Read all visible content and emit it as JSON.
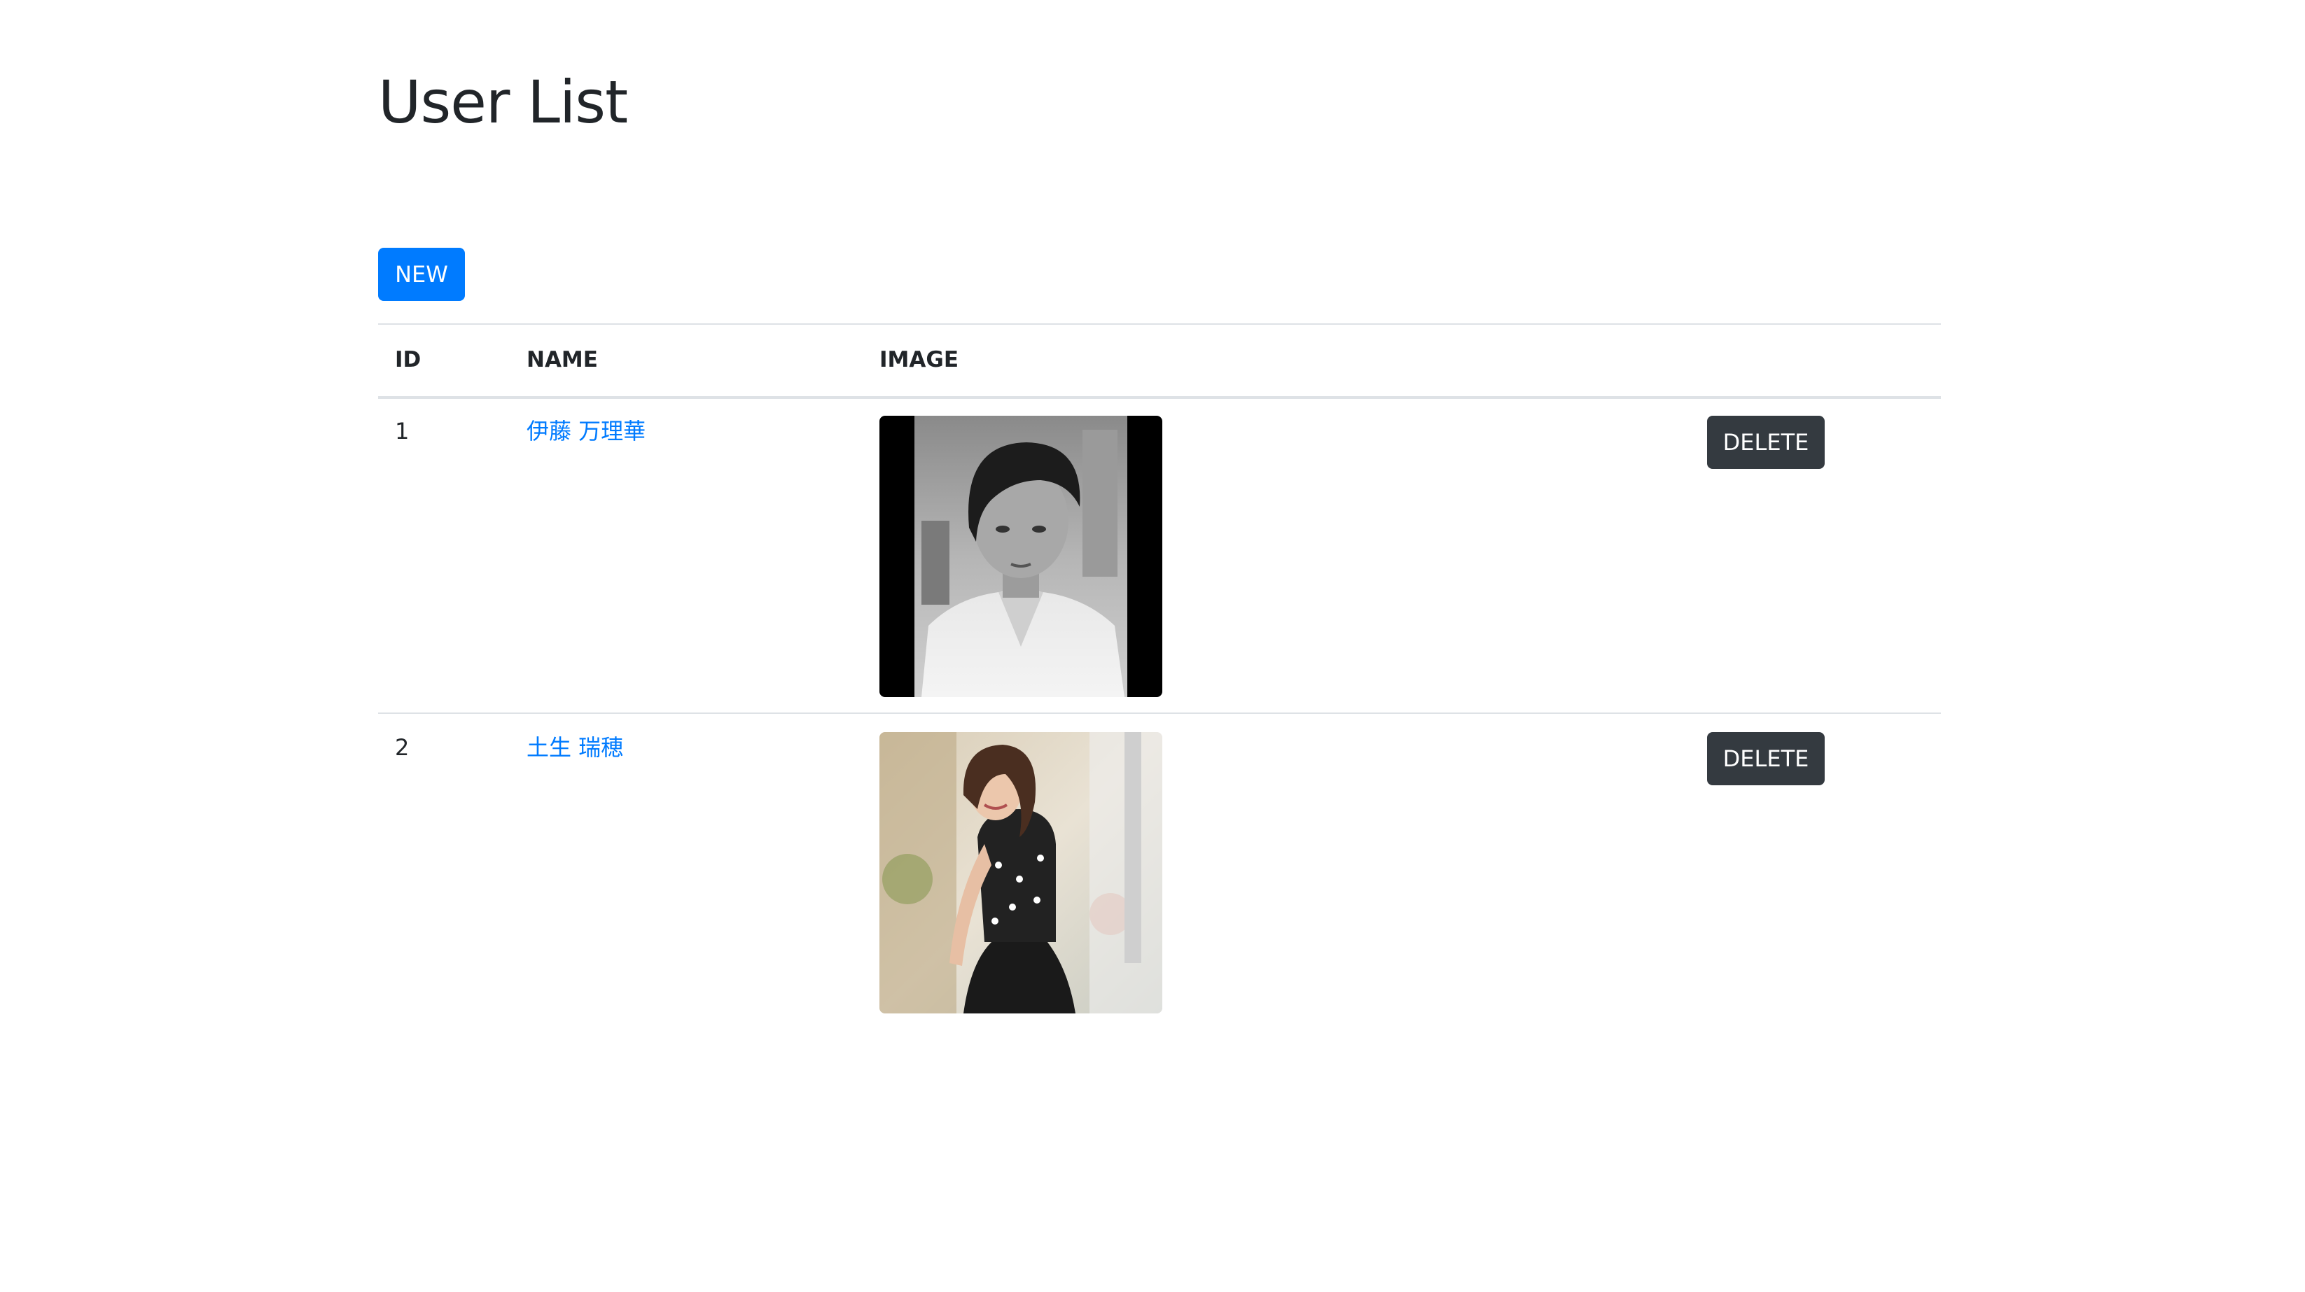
{
  "page": {
    "title": "User List"
  },
  "toolbar": {
    "new_label": "NEW"
  },
  "table": {
    "columns": [
      "ID",
      "NAME",
      "IMAGE"
    ],
    "rows": [
      {
        "id": "1",
        "name": "伊藤 万理華",
        "image_icon": "portrait-photo-bw",
        "delete_label": "DELETE"
      },
      {
        "id": "2",
        "name": "土生 瑞穂",
        "image_icon": "portrait-photo-color",
        "delete_label": "DELETE"
      }
    ]
  },
  "colors": {
    "primary": "#007bff",
    "dark": "#343a40",
    "text": "#212529",
    "border": "#dee2e6"
  }
}
